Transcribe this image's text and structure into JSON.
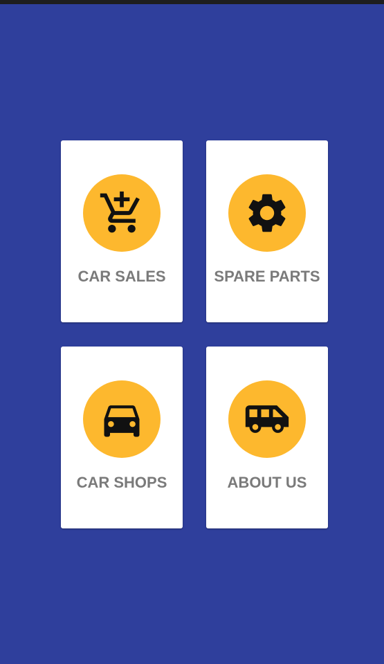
{
  "colors": {
    "background": "#2f3f9c",
    "status_bar": "#1e1e1e",
    "card": "#ffffff",
    "icon_circle": "#fdb82e",
    "icon": "#111111",
    "label": "#7a7a7a"
  },
  "menu": {
    "items": [
      {
        "label": "CAR SALES",
        "icon": "cart-add-icon"
      },
      {
        "label": "SPARE PARTS",
        "icon": "gear-icon"
      },
      {
        "label": "CAR SHOPS",
        "icon": "car-icon"
      },
      {
        "label": "ABOUT US",
        "icon": "van-icon"
      }
    ]
  }
}
